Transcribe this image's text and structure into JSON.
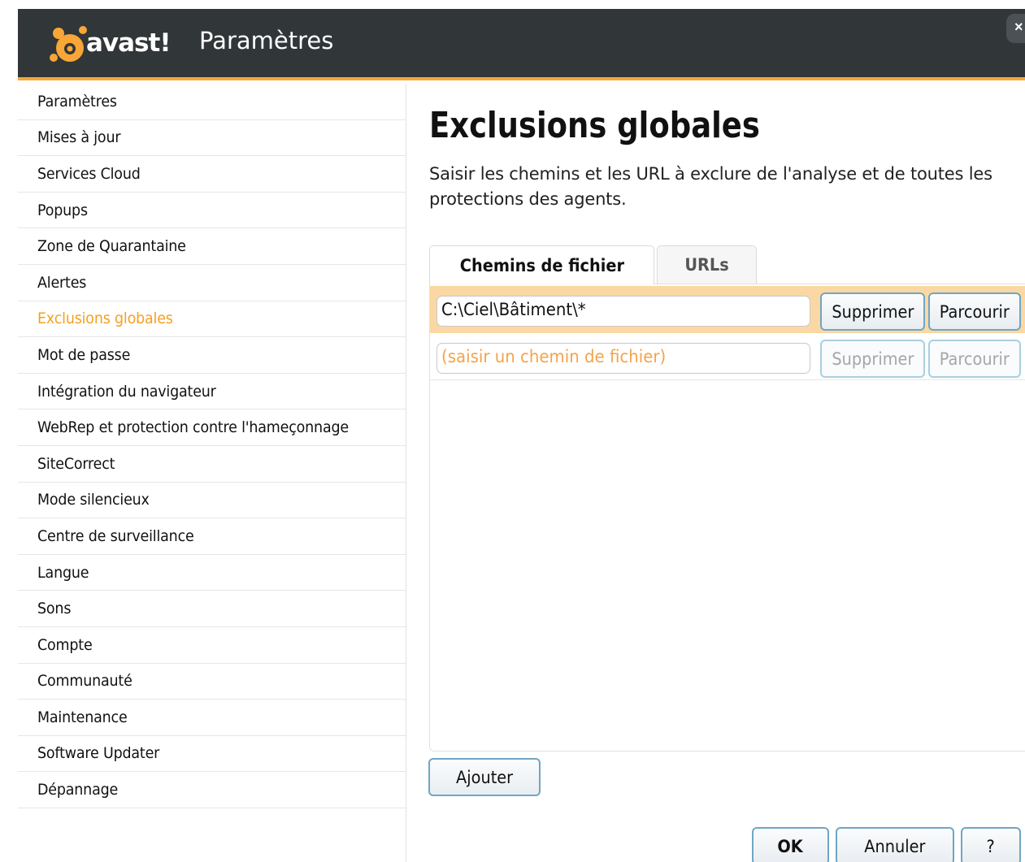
{
  "titlebar": {
    "logo_text": "avast!",
    "title": "Paramètres",
    "close_label": "×",
    "brand_color": "#f7a637",
    "bar_color": "#313638"
  },
  "sidebar": {
    "active_index": 6,
    "items": [
      {
        "label": "Paramètres"
      },
      {
        "label": "Mises à jour"
      },
      {
        "label": "Services Cloud"
      },
      {
        "label": "Popups"
      },
      {
        "label": "Zone de Quarantaine"
      },
      {
        "label": "Alertes"
      },
      {
        "label": "Exclusions globales"
      },
      {
        "label": "Mot de passe"
      },
      {
        "label": "Intégration du navigateur"
      },
      {
        "label": "WebRep et protection contre l'hameçonnage"
      },
      {
        "label": "SiteCorrect"
      },
      {
        "label": "Mode silencieux"
      },
      {
        "label": "Centre de surveillance"
      },
      {
        "label": "Langue"
      },
      {
        "label": "Sons"
      },
      {
        "label": "Compte"
      },
      {
        "label": "Communauté"
      },
      {
        "label": "Maintenance"
      },
      {
        "label": "Software Updater"
      },
      {
        "label": "Dépannage"
      }
    ]
  },
  "main": {
    "title": "Exclusions globales",
    "description": "Saisir les chemins et les URL à exclure de l'analyse et de toutes les protections des agents.",
    "tabs": [
      {
        "label": "Chemins de fichier",
        "selected": true
      },
      {
        "label": "URLs",
        "selected": false
      }
    ],
    "rows": [
      {
        "value": "C:\\Ciel\\Bâtiment\\*",
        "placeholder": "",
        "remove_label": "Supprimer",
        "browse_label": "Parcourir",
        "highlight_color": "#fbd8a3"
      },
      {
        "value": "",
        "placeholder": "(saisir un chemin de fichier)",
        "remove_label": "Supprimer",
        "browse_label": "Parcourir"
      }
    ],
    "add_label": "Ajouter"
  },
  "footer": {
    "ok_label": "OK",
    "cancel_label": "Annuler",
    "help_label": "?"
  }
}
